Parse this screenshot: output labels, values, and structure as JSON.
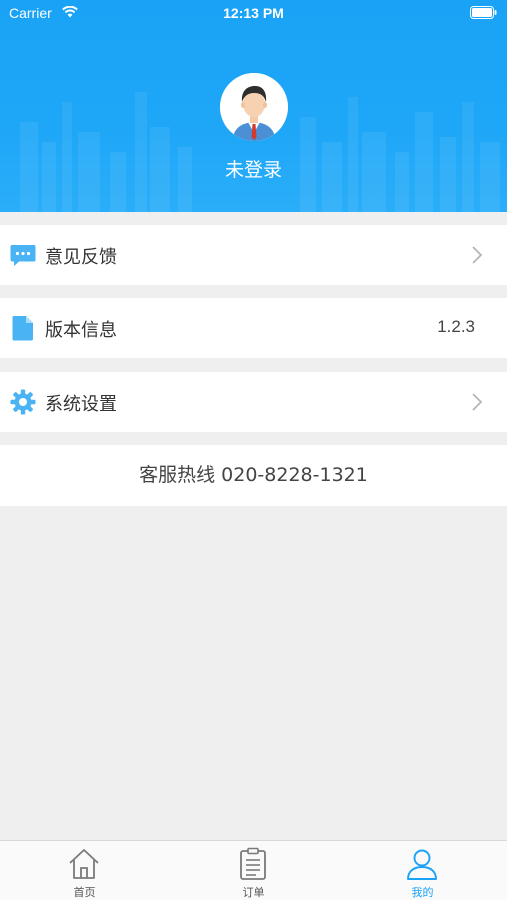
{
  "status_bar": {
    "carrier": "Carrier",
    "time": "12:13 PM"
  },
  "profile": {
    "login_status": "未登录"
  },
  "menu": {
    "feedback": {
      "label": "意见反馈",
      "icon": "chat-bubble-icon"
    },
    "version": {
      "label": "版本信息",
      "value": "1.2.3",
      "icon": "document-icon"
    },
    "settings": {
      "label": "系统设置",
      "icon": "gear-icon"
    }
  },
  "hotline": {
    "text": "客服热线 020-8228-1321"
  },
  "tabbar": {
    "tabs": [
      {
        "label": "首页",
        "icon": "home-icon",
        "active": false
      },
      {
        "label": "订单",
        "icon": "clipboard-icon",
        "active": false
      },
      {
        "label": "我的",
        "icon": "person-icon",
        "active": true
      }
    ]
  },
  "colors": {
    "accent": "#1aa3f6",
    "icon_blue": "#4ab3f4",
    "background": "#efefef"
  }
}
